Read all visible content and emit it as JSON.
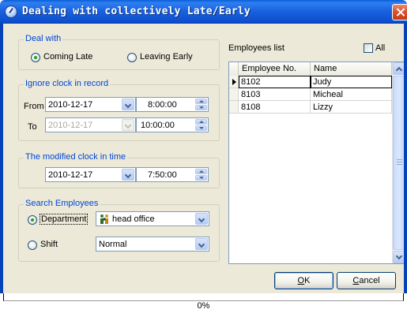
{
  "window": {
    "title": "Dealing with collectively Late/Early"
  },
  "deal_with": {
    "title": "Deal with",
    "options": [
      {
        "label": "Coming Late",
        "checked": true
      },
      {
        "label": "Leaving Early",
        "checked": false
      }
    ]
  },
  "ignore_clock": {
    "title": "Ignore clock in record",
    "from_label": "From",
    "from_date": "2010-12-17",
    "from_time": "8:00:00",
    "to_label": "To",
    "to_date": "2010-12-17",
    "to_time": "10:00:00"
  },
  "modified_clock": {
    "title": "The modified clock in time",
    "date": "2010-12-17",
    "time": "7:50:00"
  },
  "search": {
    "title": "Search Employees",
    "department_label": "Department",
    "department_checked": true,
    "department_value": "head office",
    "shift_label": "Shift",
    "shift_checked": false,
    "shift_value": "Normal"
  },
  "employees": {
    "label": "Employees list",
    "all_label": "All",
    "all_checked": false,
    "columns": [
      "Employee No.",
      "Name"
    ],
    "rows": [
      {
        "no": "8102",
        "name": "Judy"
      },
      {
        "no": "8103",
        "name": "Micheal"
      },
      {
        "no": "8108",
        "name": "Lizzy"
      }
    ]
  },
  "buttons": {
    "ok_hotkey": "O",
    "ok_rest": "K",
    "cancel_hotkey": "C",
    "cancel_rest": "ancel"
  },
  "progress": {
    "value": 0,
    "text": "0%"
  },
  "colors": {
    "titlebar": "#1a63e0",
    "group_title": "#0046d5",
    "dialog_bg": "#ece9d8",
    "close": "#d8502c"
  },
  "icons": [
    "window-app-icon",
    "close-icon",
    "department-icon",
    "chevron-down-icon",
    "spin-up-icon",
    "spin-down-icon",
    "row-pointer-icon"
  ]
}
